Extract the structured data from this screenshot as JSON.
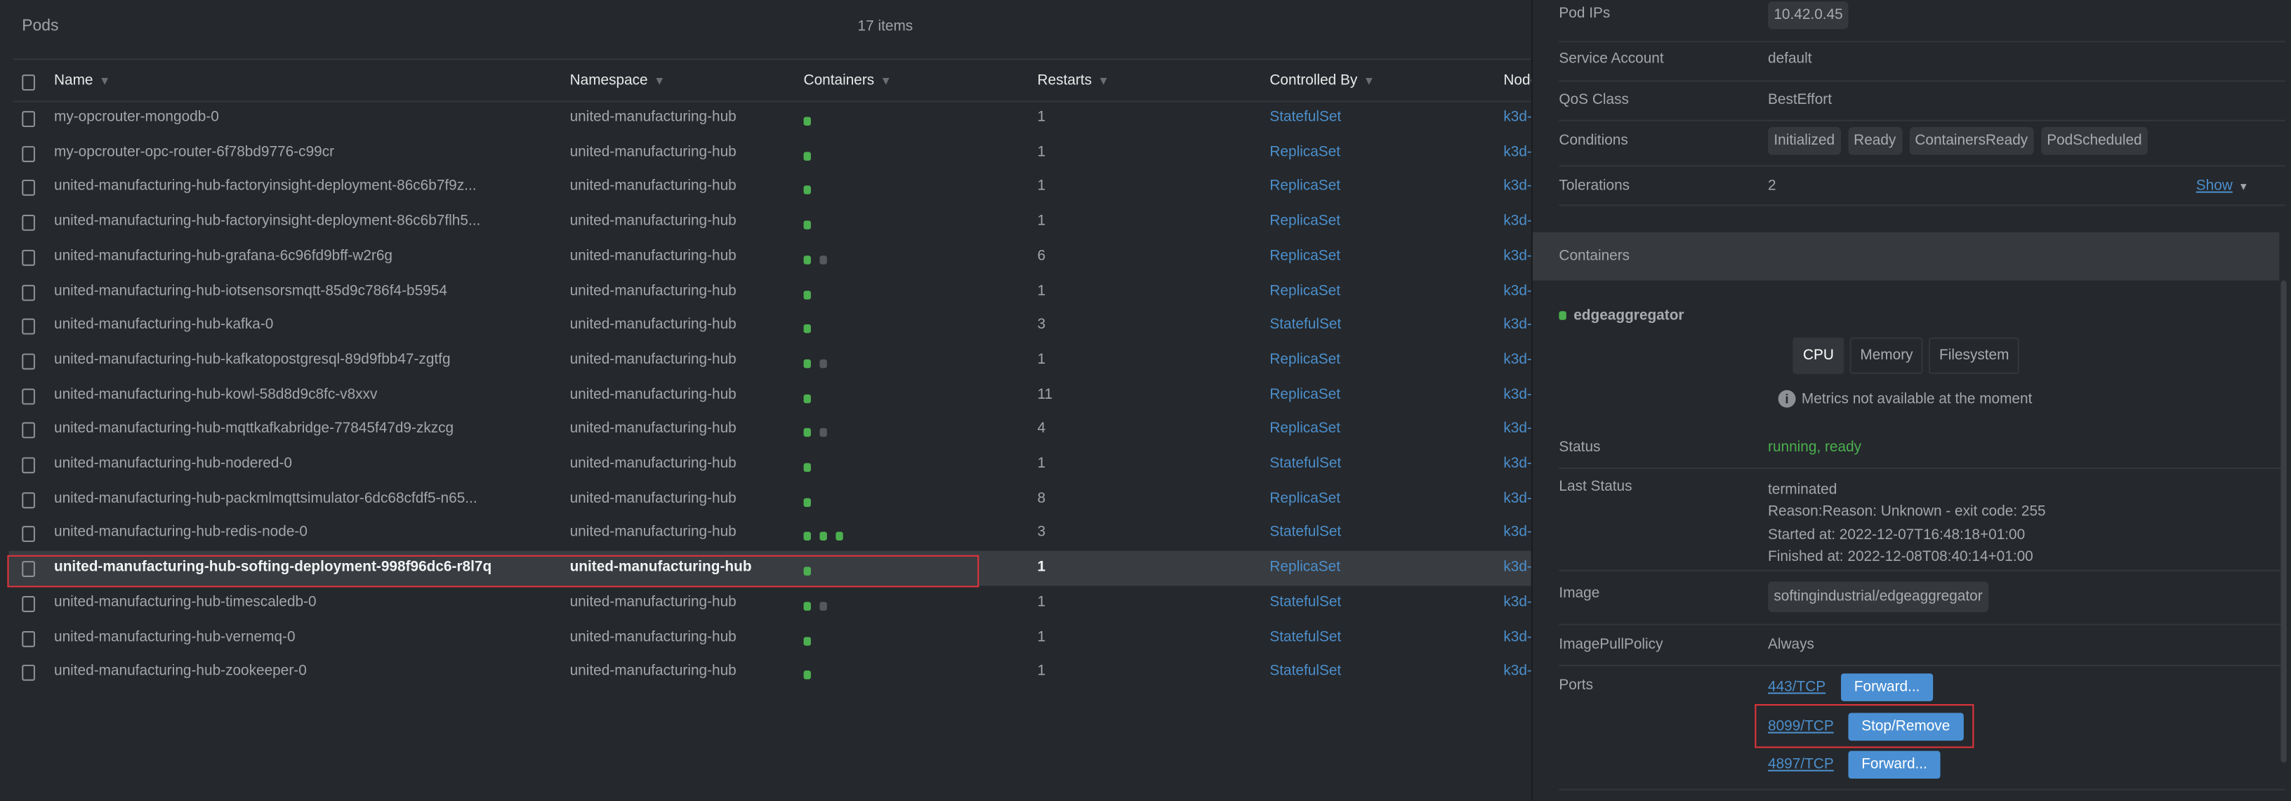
{
  "pods": {
    "title": "Pods",
    "count": "17 items",
    "columns": [
      "Name",
      "Namespace",
      "Containers",
      "Restarts",
      "Controlled By",
      "Node"
    ],
    "rows": [
      {
        "name": "my-opcrouter-mongodb-0",
        "namespace": "united-manufacturing-hub",
        "containers": [
          "ok"
        ],
        "restarts": "1",
        "controlled_by": "StatefulSet",
        "node": "k3d-"
      },
      {
        "name": "my-opcrouter-opc-router-6f78bd9776-c99cr",
        "namespace": "united-manufacturing-hub",
        "containers": [
          "ok"
        ],
        "restarts": "1",
        "controlled_by": "ReplicaSet",
        "node": "k3d-"
      },
      {
        "name": "united-manufacturing-hub-factoryinsight-deployment-86c6b7f9z...",
        "namespace": "united-manufacturing-hub",
        "containers": [
          "ok"
        ],
        "restarts": "1",
        "controlled_by": "ReplicaSet",
        "node": "k3d-"
      },
      {
        "name": "united-manufacturing-hub-factoryinsight-deployment-86c6b7flh5...",
        "namespace": "united-manufacturing-hub",
        "containers": [
          "ok"
        ],
        "restarts": "1",
        "controlled_by": "ReplicaSet",
        "node": "k3d-"
      },
      {
        "name": "united-manufacturing-hub-grafana-6c96fd9bff-w2r6g",
        "namespace": "united-manufacturing-hub",
        "containers": [
          "ok",
          "off"
        ],
        "restarts": "6",
        "controlled_by": "ReplicaSet",
        "node": "k3d-"
      },
      {
        "name": "united-manufacturing-hub-iotsensorsmqtt-85d9c786f4-b5954",
        "namespace": "united-manufacturing-hub",
        "containers": [
          "ok"
        ],
        "restarts": "1",
        "controlled_by": "ReplicaSet",
        "node": "k3d-"
      },
      {
        "name": "united-manufacturing-hub-kafka-0",
        "namespace": "united-manufacturing-hub",
        "containers": [
          "ok"
        ],
        "restarts": "3",
        "controlled_by": "StatefulSet",
        "node": "k3d-"
      },
      {
        "name": "united-manufacturing-hub-kafkatopostgresql-89d9fbb47-zgtfg",
        "namespace": "united-manufacturing-hub",
        "containers": [
          "ok",
          "off"
        ],
        "restarts": "1",
        "controlled_by": "ReplicaSet",
        "node": "k3d-"
      },
      {
        "name": "united-manufacturing-hub-kowl-58d8d9c8fc-v8xxv",
        "namespace": "united-manufacturing-hub",
        "containers": [
          "ok"
        ],
        "restarts": "11",
        "controlled_by": "ReplicaSet",
        "node": "k3d-"
      },
      {
        "name": "united-manufacturing-hub-mqttkafkabridge-77845f47d9-zkzcg",
        "namespace": "united-manufacturing-hub",
        "containers": [
          "ok",
          "off"
        ],
        "restarts": "4",
        "controlled_by": "ReplicaSet",
        "node": "k3d-"
      },
      {
        "name": "united-manufacturing-hub-nodered-0",
        "namespace": "united-manufacturing-hub",
        "containers": [
          "ok"
        ],
        "restarts": "1",
        "controlled_by": "StatefulSet",
        "node": "k3d-"
      },
      {
        "name": "united-manufacturing-hub-packmlmqttsimulator-6dc68cfdf5-n65...",
        "namespace": "united-manufacturing-hub",
        "containers": [
          "ok"
        ],
        "restarts": "8",
        "controlled_by": "ReplicaSet",
        "node": "k3d-"
      },
      {
        "name": "united-manufacturing-hub-redis-node-0",
        "namespace": "united-manufacturing-hub",
        "containers": [
          "ok",
          "ok",
          "ok"
        ],
        "restarts": "3",
        "controlled_by": "StatefulSet",
        "node": "k3d-"
      },
      {
        "name": "united-manufacturing-hub-softing-deployment-998f96dc6-r8l7q",
        "namespace": "united-manufacturing-hub",
        "containers": [
          "ok"
        ],
        "restarts": "1",
        "controlled_by": "ReplicaSet",
        "node": "k3d-",
        "selected": true
      },
      {
        "name": "united-manufacturing-hub-timescaledb-0",
        "namespace": "united-manufacturing-hub",
        "containers": [
          "ok",
          "off"
        ],
        "restarts": "1",
        "controlled_by": "StatefulSet",
        "node": "k3d-"
      },
      {
        "name": "united-manufacturing-hub-vernemq-0",
        "namespace": "united-manufacturing-hub",
        "containers": [
          "ok"
        ],
        "restarts": "1",
        "controlled_by": "StatefulSet",
        "node": "k3d-"
      },
      {
        "name": "united-manufacturing-hub-zookeeper-0",
        "namespace": "united-manufacturing-hub",
        "containers": [
          "ok"
        ],
        "restarts": "1",
        "controlled_by": "StatefulSet",
        "node": "k3d-"
      }
    ]
  },
  "details": {
    "pod_ips_label": "Pod IPs",
    "pod_ip": "10.42.0.45",
    "service_account_label": "Service Account",
    "service_account": "default",
    "qos_label": "QoS Class",
    "qos": "BestEffort",
    "conditions_label": "Conditions",
    "conditions": [
      "Initialized",
      "Ready",
      "ContainersReady",
      "PodScheduled"
    ],
    "tolerations_label": "Tolerations",
    "tolerations": "2",
    "show_label": "Show",
    "containers_header": "Containers",
    "container_name": "edgeaggregator",
    "metric_tabs": [
      "CPU",
      "Memory",
      "Filesystem"
    ],
    "metrics_message": "Metrics not available at the moment",
    "status_label": "Status",
    "status": "running, ready",
    "last_status_label": "Last Status",
    "last_status": [
      "terminated",
      "Reason:Reason: Unknown - exit code: 255",
      "Started at: 2022-12-07T16:48:18+01:00",
      "Finished at: 2022-12-08T08:40:14+01:00"
    ],
    "image_label": "Image",
    "image": "softingindustrial/edgeaggregator",
    "pull_policy_label": "ImagePullPolicy",
    "pull_policy": "Always",
    "ports_label": "Ports",
    "ports": [
      {
        "port": "443/TCP",
        "action": "Forward..."
      },
      {
        "port": "8099/TCP",
        "action": "Stop/Remove"
      },
      {
        "port": "4897/TCP",
        "action": "Forward..."
      }
    ]
  },
  "colors": {
    "ok": "#4caf50",
    "off": "#55585d",
    "link": "#4c8fcc",
    "highlight": "#e0343b",
    "button": "#4a8fd3"
  }
}
